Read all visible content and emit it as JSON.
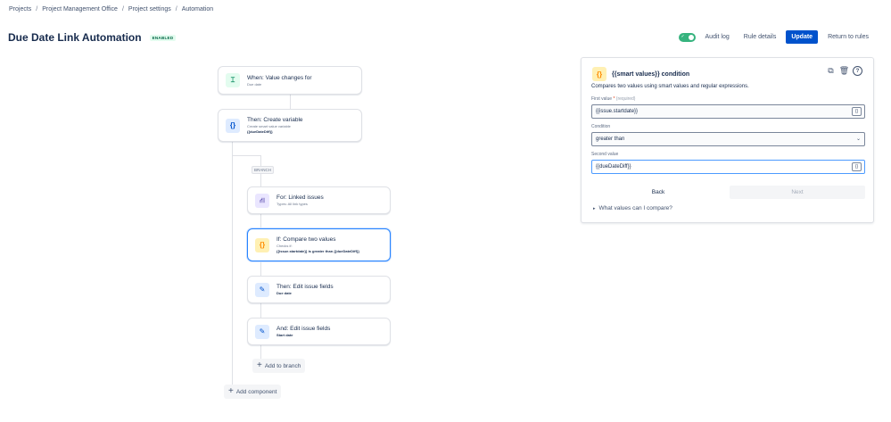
{
  "breadcrumbs": [
    "Projects",
    "Project Management Office",
    "Project settings",
    "Automation"
  ],
  "breadcrumb_separator": "/",
  "page": {
    "title": "Due Date Link Automation",
    "status_badge": "ENABLED"
  },
  "header_actions": {
    "toggle_check": "✓",
    "audit_log": "Audit log",
    "rule_details": "Rule details",
    "update": "Update",
    "return_to_rules": "Return to rules"
  },
  "flow": {
    "trigger": {
      "title": "When: Value changes for",
      "sub": "Due date",
      "icon": "trigger-icon",
      "glyph": "⌶"
    },
    "create_variable": {
      "title": "Then: Create variable",
      "sub": "Create smart value variable",
      "sub2": "{{dueDateDiff}}",
      "icon": "smart-value-icon",
      "glyph": "{}"
    },
    "branch_label": "BRANCH",
    "branch_for": {
      "title": "For: Linked issues",
      "sub": "Types: All link types",
      "icon": "branch-icon",
      "glyph": "⛙"
    },
    "condition": {
      "title": "If: Compare two values",
      "sub": "Checks if:",
      "sub2": "{{issue.startdate}} is greater than {{dueDateDiff}}",
      "icon": "condition-icon",
      "glyph": "{}"
    },
    "edit_due": {
      "title": "Then: Edit issue fields",
      "sub2": "Due date",
      "icon": "pencil-icon",
      "glyph": "✎"
    },
    "edit_start": {
      "title": "And: Edit issue fields",
      "sub2": "Start date",
      "icon": "pencil-icon",
      "glyph": "✎"
    },
    "add_to_branch": "Add to branch",
    "add_component": "Add component",
    "plus": "+"
  },
  "panel": {
    "glyph": "{}",
    "title": "{{smart values}} condition",
    "description": "Compares two values using smart values and regular expressions.",
    "first_value_label": "First value",
    "required_mark": "*",
    "required_hint": "(required)",
    "first_value": "{{issue.startdate}}",
    "condition_label": "Condition",
    "condition_value": "greater than",
    "second_value_label": "Second value",
    "second_value": "{{dueDateDiff}}",
    "smart_glyph": "{}",
    "chevron": "⌄",
    "back": "Back",
    "next": "Next",
    "expander": "What values can I compare?",
    "caret": "▸",
    "tools": {
      "copy": "⧉",
      "delete": "🗑",
      "help": "?"
    }
  },
  "colors": {
    "primary": "#0052cc",
    "toggle_on": "#36b37e",
    "selected_border": "#2684ff"
  }
}
